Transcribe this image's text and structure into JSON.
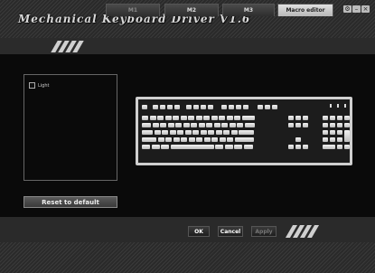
{
  "window": {
    "title": "Mechanical Keyboard Driver V1.6",
    "controls": [
      "gear-icon",
      "minimize-icon",
      "close-icon"
    ]
  },
  "tabs": [
    {
      "label": "M1",
      "state": "dim"
    },
    {
      "label": "M2",
      "state": "normal"
    },
    {
      "label": "M3",
      "state": "normal"
    },
    {
      "label": "Macro editor",
      "state": "active"
    }
  ],
  "light_panel": {
    "checkbox_label": "Light",
    "checked": false
  },
  "reset_button": "Reset to default",
  "keyboard": {
    "name": "keyboard-layout",
    "key_color": "#e8e8e8"
  },
  "footer": {
    "ok": "OK",
    "cancel": "Cancel",
    "apply": "Apply"
  }
}
